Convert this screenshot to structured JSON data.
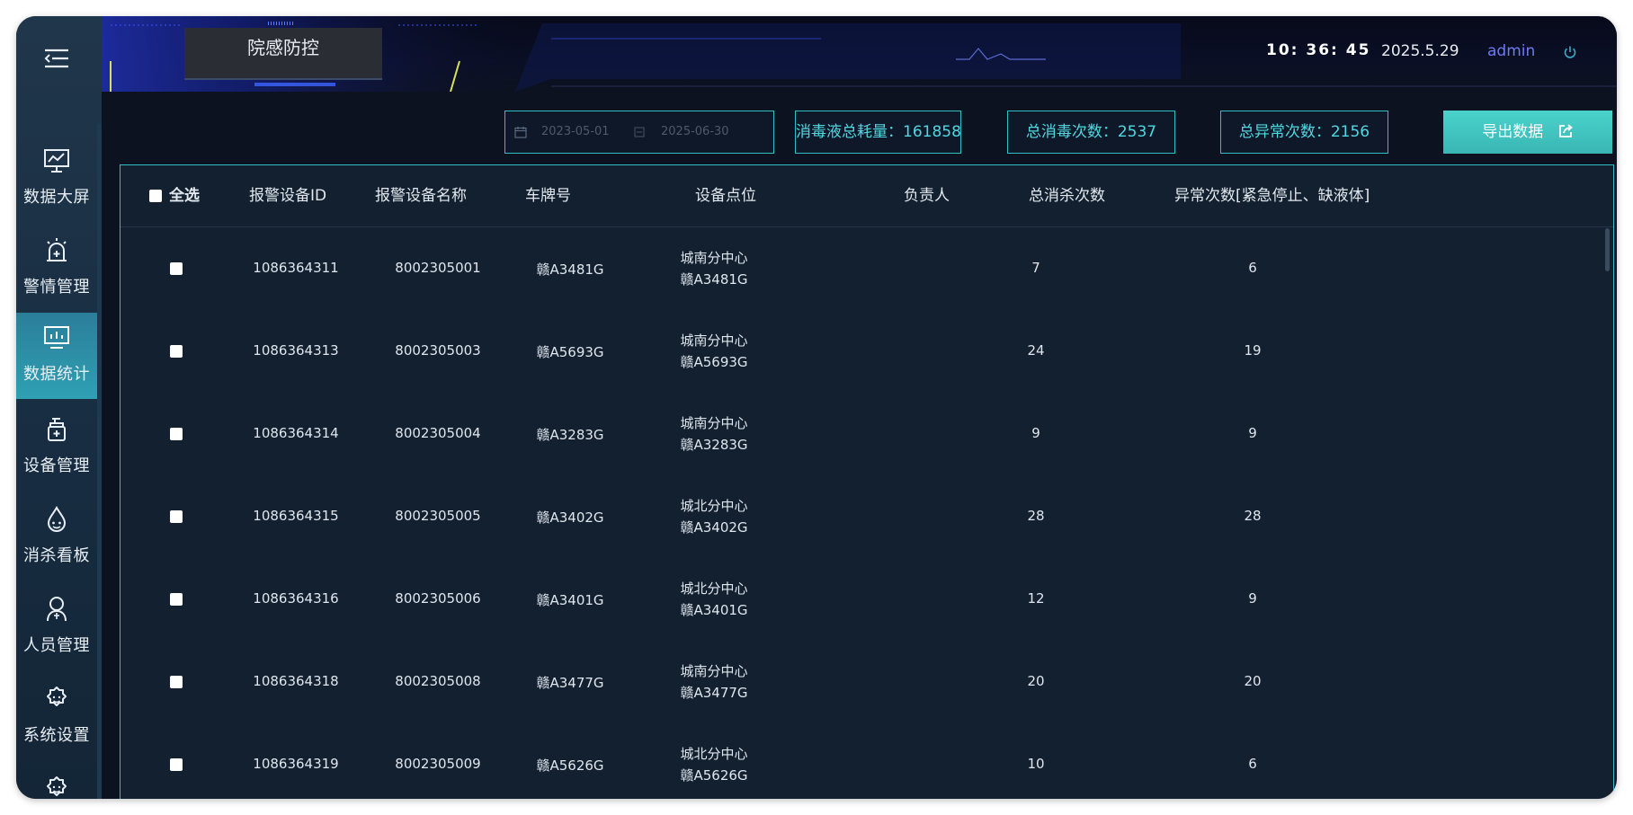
{
  "app": {
    "title": "院感防控"
  },
  "header": {
    "clock": "10: 36: 45",
    "date": "2025.5.29",
    "user": "admin"
  },
  "sidebar": {
    "items": [
      {
        "label": "数据大屏",
        "icon": "monitor-chart-icon"
      },
      {
        "label": "警情管理",
        "icon": "alarm-siren-icon"
      },
      {
        "label": "数据统计",
        "icon": "bar-chart-monitor-icon",
        "active": true
      },
      {
        "label": "设备管理",
        "icon": "dispenser-bottle-icon"
      },
      {
        "label": "消杀看板",
        "icon": "droplet-icon"
      },
      {
        "label": "人员管理",
        "icon": "person-icon"
      },
      {
        "label": "系统设置",
        "icon": "gear-icon"
      },
      {
        "label": "",
        "icon": "gear-icon"
      }
    ]
  },
  "toolbar": {
    "date_start_placeholder": "2023-05-01",
    "date_end_placeholder": "2025-06-30",
    "disinfectant_total": "消毒液总耗量：161858",
    "disinfect_count": "总消毒次数：2537",
    "abnormal_count": "总异常次数：2156",
    "export_label": "导出数据"
  },
  "table": {
    "headers": {
      "select_all": "全选",
      "device_id": "报警设备ID",
      "device_name": "报警设备名称",
      "plate": "车牌号",
      "location": "设备点位",
      "owner": "负责人",
      "total": "总消杀次数",
      "abnormal": "异常次数[紧急停止、缺液体]"
    },
    "rows": [
      {
        "id": "1086364311",
        "name": "8002305001",
        "plate": "赣A3481G",
        "loc1": "城南分中心",
        "loc2": "赣A3481G",
        "owner": "",
        "total": "7",
        "abnormal": "6"
      },
      {
        "id": "1086364313",
        "name": "8002305003",
        "plate": "赣A5693G",
        "loc1": "城南分中心",
        "loc2": "赣A5693G",
        "owner": "",
        "total": "24",
        "abnormal": "19"
      },
      {
        "id": "1086364314",
        "name": "8002305004",
        "plate": "赣A3283G",
        "loc1": "城南分中心",
        "loc2": "赣A3283G",
        "owner": "",
        "total": "9",
        "abnormal": "9"
      },
      {
        "id": "1086364315",
        "name": "8002305005",
        "plate": "赣A3402G",
        "loc1": "城北分中心",
        "loc2": "赣A3402G",
        "owner": "",
        "total": "28",
        "abnormal": "28"
      },
      {
        "id": "1086364316",
        "name": "8002305006",
        "plate": "赣A3401G",
        "loc1": "城北分中心",
        "loc2": "赣A3401G",
        "owner": "",
        "total": "12",
        "abnormal": "9"
      },
      {
        "id": "1086364318",
        "name": "8002305008",
        "plate": "赣A3477G",
        "loc1": "城南分中心",
        "loc2": "赣A3477G",
        "owner": "",
        "total": "20",
        "abnormal": "20"
      },
      {
        "id": "1086364319",
        "name": "8002305009",
        "plate": "赣A5626G",
        "loc1": "城北分中心",
        "loc2": "赣A5626G",
        "owner": "",
        "total": "10",
        "abnormal": "6"
      }
    ]
  },
  "colors": {
    "accent": "#2fbfc4",
    "stat_text": "#4fd8e0",
    "user_link": "#6f7cf0",
    "active_nav": "#2fa0b4"
  }
}
